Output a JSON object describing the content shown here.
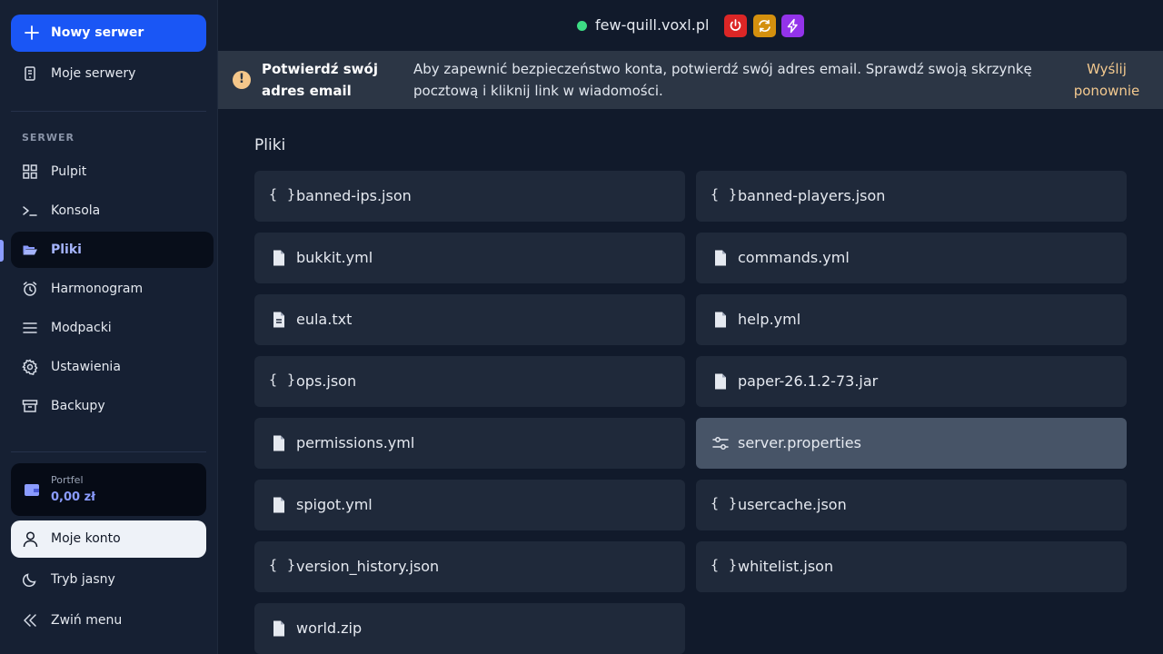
{
  "sidebar": {
    "new_server": "Nowy serwer",
    "my_servers": "Moje serwery",
    "section": "SERWER",
    "items": [
      {
        "label": "Pulpit",
        "icon": "grid-icon"
      },
      {
        "label": "Konsola",
        "icon": "terminal-icon"
      },
      {
        "label": "Pliki",
        "icon": "folder-open-icon",
        "active": true
      },
      {
        "label": "Harmonogram",
        "icon": "alarm-clock-icon"
      },
      {
        "label": "Modpacki",
        "icon": "list-icon"
      },
      {
        "label": "Ustawienia",
        "icon": "gear-icon"
      },
      {
        "label": "Backupy",
        "icon": "archive-icon"
      }
    ],
    "wallet_label": "Portfel",
    "wallet_value": "0,00 zł",
    "account": "Moje konto",
    "theme": "Tryb jasny",
    "collapse": "Zwiń menu"
  },
  "header": {
    "server_name": "few-quill.voxl.pl",
    "status_color": "#3ddc84",
    "buttons": [
      {
        "name": "power-button",
        "icon": "power-icon",
        "color": "#dc2626"
      },
      {
        "name": "restart-button",
        "icon": "refresh-icon",
        "color": "#d4900e"
      },
      {
        "name": "kill-button",
        "icon": "lightning-icon",
        "color": "#9333ea"
      }
    ]
  },
  "banner": {
    "title": "Potwierdź swój adres email",
    "message": "Aby zapewnić bezpieczeństwo konta, potwierdź swój adres email. Sprawdź swoją skrzynkę pocztową i kliknij link w wiadomości.",
    "link": "Wyślij ponownie"
  },
  "files": {
    "title": "Pliki",
    "items": [
      {
        "name": "banned-ips.json",
        "type": "json"
      },
      {
        "name": "banned-players.json",
        "type": "json"
      },
      {
        "name": "bukkit.yml",
        "type": "file"
      },
      {
        "name": "commands.yml",
        "type": "file"
      },
      {
        "name": "eula.txt",
        "type": "text"
      },
      {
        "name": "help.yml",
        "type": "file"
      },
      {
        "name": "ops.json",
        "type": "json"
      },
      {
        "name": "paper-26.1.2-73.jar",
        "type": "file"
      },
      {
        "name": "permissions.yml",
        "type": "file"
      },
      {
        "name": "server.properties",
        "type": "settings",
        "highlighted": true
      },
      {
        "name": "spigot.yml",
        "type": "file"
      },
      {
        "name": "usercache.json",
        "type": "json"
      },
      {
        "name": "version_history.json",
        "type": "json"
      },
      {
        "name": "whitelist.json",
        "type": "json"
      },
      {
        "name": "world.zip",
        "type": "file"
      }
    ]
  }
}
